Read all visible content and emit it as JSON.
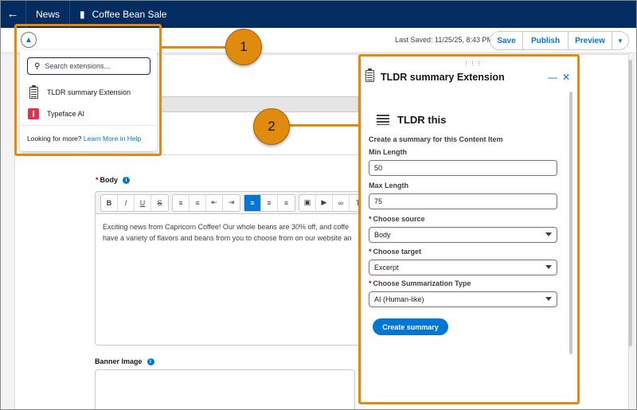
{
  "topbar": {
    "back_icon": "back-arrow-icon",
    "tabs": [
      "News",
      "Coffee Bean Sale"
    ]
  },
  "toolbar": {
    "extensions_icon": "extensions-icon",
    "last_saved": "Last Saved: 11/25/25, 8:43 PM",
    "save_label": "Save",
    "publish_label": "Publish",
    "preview_label": "Preview"
  },
  "extensions_menu": {
    "search_placeholder": "Search extensions...",
    "items": [
      "TLDR summary Extension",
      "Typeface AI"
    ],
    "more_text": "Looking for more?",
    "more_link": "Learn More in Help"
  },
  "editor": {
    "body_label": "Body",
    "body_text_line1": "Exciting news from Capricorn Coffee! Our whole beans are 30% off, and coffe",
    "body_text_line2": "have a variety of flavors and beans from you to choose from on our website an",
    "banner_label": "Banner Image"
  },
  "panel": {
    "title": "TLDR summary Extension",
    "heading": "TLDR this",
    "description": "Create a summary for this Content Item",
    "min_length_label": "Min Length",
    "min_length_value": "50",
    "max_length_label": "Max Length",
    "max_length_value": "75",
    "source_label": "Choose source",
    "source_value": "Body",
    "target_label": "Choose target",
    "target_value": "Excerpt",
    "type_label": "Choose Summarization Type",
    "type_value": "AI (Human-like)",
    "create_label": "Create summary"
  },
  "callouts": [
    "1",
    "2"
  ],
  "colors": {
    "header_bg": "#032d60",
    "brand_blue": "#0176d3",
    "callout_orange": "#e08a0e",
    "required_red": "#ba0517"
  }
}
